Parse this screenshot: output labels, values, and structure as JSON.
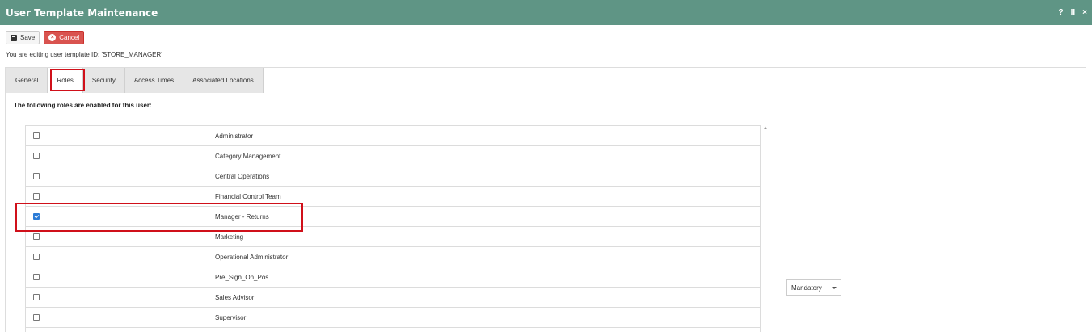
{
  "window": {
    "title": "User Template Maintenance",
    "controls": [
      "?",
      "II",
      "×"
    ]
  },
  "toolbar": {
    "save_label": "Save",
    "cancel_label": "Cancel"
  },
  "editing_message": "You are editing user template ID: 'STORE_MANAGER'",
  "tabs": [
    {
      "label": "General",
      "active": false
    },
    {
      "label": "Roles",
      "active": true
    },
    {
      "label": "Security",
      "active": false
    },
    {
      "label": "Access Times",
      "active": false
    },
    {
      "label": "Associated Locations",
      "active": false
    }
  ],
  "roles_heading": "The following roles are enabled for this user:",
  "roles": [
    {
      "name": "Administrator",
      "checked": false
    },
    {
      "name": "Category Management",
      "checked": false
    },
    {
      "name": "Central Operations",
      "checked": false
    },
    {
      "name": "Financial Control Team",
      "checked": false
    },
    {
      "name": "Manager - Returns",
      "checked": true
    },
    {
      "name": "Marketing",
      "checked": false
    },
    {
      "name": "Operational Administrator",
      "checked": false
    },
    {
      "name": "Pre_Sign_On_Pos",
      "checked": false
    },
    {
      "name": "Sales Advisor",
      "checked": false
    },
    {
      "name": "Supervisor",
      "checked": false
    }
  ],
  "dropdown": {
    "selected": "Mandatory"
  },
  "colors": {
    "titlebar": "#5f9585",
    "cancel": "#d9534f",
    "highlight": "#d0101a",
    "checkbox_checked": "#2b7bd6"
  }
}
